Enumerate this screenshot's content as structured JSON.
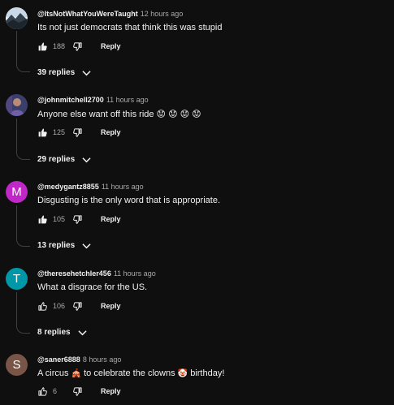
{
  "comments": [
    {
      "handle": "@ItsNotWhatYouWereTaught",
      "time": "12 hours ago",
      "text": "Its not just democrats that think this was stupid",
      "likes": "188",
      "reply_label": "Reply",
      "replies_label": "39 replies",
      "avatar_kind": "landscape-photo",
      "liked": true
    },
    {
      "handle": "@johnmitchell2700",
      "time": "11 hours ago",
      "text": "Anyone else want off this ride 😟 😟 😟 😟",
      "likes": "125",
      "reply_label": "Reply",
      "replies_label": "29 replies",
      "avatar_kind": "person-photo",
      "liked": true
    },
    {
      "handle": "@medygantz8855",
      "time": "11 hours ago",
      "text": "Disgusting is the only word that is appropriate.",
      "likes": "105",
      "reply_label": "Reply",
      "replies_label": "13 replies",
      "avatar_letter": "M",
      "avatar_color": "#c027c7",
      "liked": true
    },
    {
      "handle": "@theresehetchler456",
      "time": "11 hours ago",
      "text": "What a disgrace for the US.",
      "likes": "106",
      "reply_label": "Reply",
      "replies_label": "8 replies",
      "avatar_letter": "T",
      "avatar_color": "#0097a7",
      "liked": false
    },
    {
      "handle": "@saner6888",
      "time": "8 hours ago",
      "text_parts": [
        "A circus",
        "🎪",
        "to celebrate the clowns",
        "🤡",
        "birthday!"
      ],
      "likes": "6",
      "reply_label": "Reply",
      "avatar_letter": "S",
      "avatar_color": "#795548",
      "liked": false
    }
  ],
  "icons": {
    "like": "thumbs-up-icon",
    "dislike": "thumbs-down-icon",
    "expand": "chevron-down-icon"
  },
  "colors": {
    "background": "#0f0f0f",
    "text": "#f1f1f1",
    "secondary_text": "#aaaaaa",
    "thread_line": "#3f3f3f"
  }
}
